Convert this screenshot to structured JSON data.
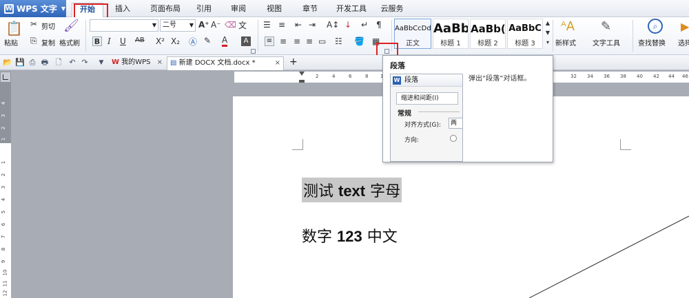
{
  "app": {
    "name": "WPS 文字",
    "logo": "W"
  },
  "menu_tabs": [
    "开始",
    "插入",
    "页面布局",
    "引用",
    "审阅",
    "视图",
    "章节",
    "开发工具",
    "云服务"
  ],
  "ribbon": {
    "paste": "粘贴",
    "cut": "剪切",
    "copy": "复制",
    "format_painter": "格式刷",
    "font_name": "",
    "font_size": "二号",
    "styles": [
      {
        "sample": "AaBbCcDd",
        "name": "正文"
      },
      {
        "sample": "AaBb",
        "name": "标题 1"
      },
      {
        "sample": "AaBb(",
        "name": "标题 2"
      },
      {
        "sample": "AaBbC",
        "name": "标题 3"
      }
    ],
    "new_style": "新样式",
    "text_tools": "文字工具",
    "find_replace": "查找替换",
    "select": "选择"
  },
  "tabs": {
    "my_wps": "我的WPS",
    "document": "新建 DOCX 文档.docx *",
    "add": "+"
  },
  "tooltip": {
    "title": "段落",
    "description": "弹出“段落”对话框。",
    "dialog_title": "段落",
    "tab_label": "缩进和间距(I)",
    "section": "常规",
    "align_label": "对齐方式(G):",
    "align_value": "两",
    "direction_label": "方向:"
  },
  "ruler": {
    "h_ticks": [
      "6",
      "4",
      "2",
      "2",
      "4",
      "6",
      "8",
      "10",
      "32",
      "34",
      "36",
      "38",
      "40",
      "42",
      "44",
      "46"
    ],
    "v_ticks": [
      "4",
      "3",
      "2",
      "1",
      "1",
      "2",
      "3",
      "4",
      "5",
      "6",
      "7",
      "8",
      "9",
      "10",
      "11",
      "12"
    ]
  },
  "document": {
    "line1": {
      "pre": "测试 ",
      "bold": "text",
      "post": " 字母"
    },
    "line2": {
      "pre": "数字 ",
      "bold": "123",
      "post": " 中文"
    }
  },
  "colors": {
    "accent": "#2f65b8",
    "highlight": "#e02020"
  }
}
